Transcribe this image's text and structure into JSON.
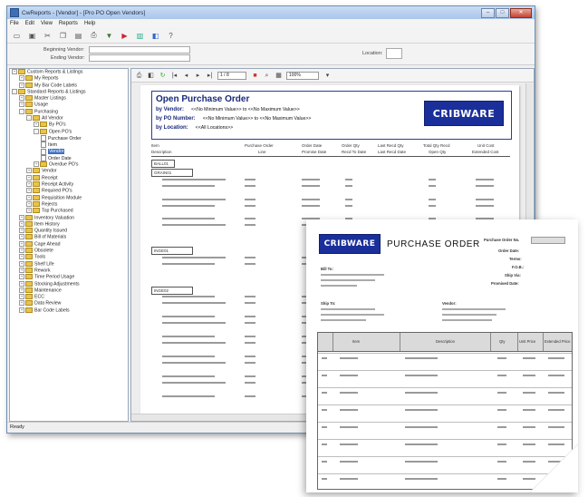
{
  "window": {
    "title": "CwReports - [Vendor] - [Pro PO Open Vendors]",
    "menus": [
      "File",
      "Edit",
      "View",
      "Reports",
      "Help"
    ]
  },
  "params": {
    "beginning_vendor_label": "Beginning Vendor:",
    "ending_vendor_label": "Ending Vendor:",
    "location_label": "Location:"
  },
  "tree": [
    {
      "label": "Custom Reports & Listings",
      "kind": "folder",
      "indent": 0,
      "expander": "+"
    },
    {
      "label": "My Reports",
      "kind": "folder",
      "indent": 1,
      "expander": "+"
    },
    {
      "label": "My Bar Code Labels",
      "kind": "folder",
      "indent": 1,
      "expander": "+"
    },
    {
      "label": "Standard Reports & Listings",
      "kind": "folder",
      "indent": 0,
      "expander": "-"
    },
    {
      "label": "Master Listings",
      "kind": "folder",
      "indent": 1,
      "expander": "+"
    },
    {
      "label": "Usage",
      "kind": "folder",
      "indent": 1,
      "expander": "+"
    },
    {
      "label": "Purchasing",
      "kind": "folder",
      "indent": 1,
      "expander": "-"
    },
    {
      "label": "All Vendor",
      "kind": "folder",
      "indent": 2,
      "expander": "-"
    },
    {
      "label": "By PO's",
      "kind": "folder",
      "indent": 3,
      "expander": "+"
    },
    {
      "label": "Open PO's",
      "kind": "folder",
      "indent": 3,
      "expander": "-"
    },
    {
      "label": "Purchase Order",
      "kind": "doc",
      "indent": 4,
      "expander": ""
    },
    {
      "label": "Item",
      "kind": "doc",
      "indent": 4,
      "expander": ""
    },
    {
      "label": "Vendor",
      "kind": "doc",
      "indent": 4,
      "expander": "",
      "selected": true
    },
    {
      "label": "Order Date",
      "kind": "doc",
      "indent": 4,
      "expander": ""
    },
    {
      "label": "Overdue PO's",
      "kind": "folder",
      "indent": 3,
      "expander": "+"
    },
    {
      "label": "Vendor",
      "kind": "folder",
      "indent": 2,
      "expander": "+"
    },
    {
      "label": "Receipt",
      "kind": "folder",
      "indent": 2,
      "expander": "+"
    },
    {
      "label": "Receipt Activity",
      "kind": "folder",
      "indent": 2,
      "expander": "+"
    },
    {
      "label": "Required PO's",
      "kind": "folder",
      "indent": 2,
      "expander": "+"
    },
    {
      "label": "Requisition Module",
      "kind": "folder",
      "indent": 2,
      "expander": "+"
    },
    {
      "label": "Rejects",
      "kind": "folder",
      "indent": 2,
      "expander": "+"
    },
    {
      "label": "Top Purchased",
      "kind": "folder",
      "indent": 2,
      "expander": "+"
    },
    {
      "label": "Inventory Valuation",
      "kind": "folder",
      "indent": 1,
      "expander": "+"
    },
    {
      "label": "Item History",
      "kind": "folder",
      "indent": 1,
      "expander": "+"
    },
    {
      "label": "Quantity Issued",
      "kind": "folder",
      "indent": 1,
      "expander": "+"
    },
    {
      "label": "Bill of Materials",
      "kind": "folder",
      "indent": 1,
      "expander": "+"
    },
    {
      "label": "Cage Ahead",
      "kind": "folder",
      "indent": 1,
      "expander": "+"
    },
    {
      "label": "Obsolete",
      "kind": "folder",
      "indent": 1,
      "expander": "+"
    },
    {
      "label": "Tools",
      "kind": "folder",
      "indent": 1,
      "expander": "+"
    },
    {
      "label": "Shelf Life",
      "kind": "folder",
      "indent": 1,
      "expander": "+"
    },
    {
      "label": "Rework",
      "kind": "folder",
      "indent": 1,
      "expander": "+"
    },
    {
      "label": "Time Period Usage",
      "kind": "folder",
      "indent": 1,
      "expander": "+"
    },
    {
      "label": "Stocking Adjustments",
      "kind": "folder",
      "indent": 1,
      "expander": "+"
    },
    {
      "label": "Maintenance",
      "kind": "folder",
      "indent": 1,
      "expander": "+"
    },
    {
      "label": "ECC",
      "kind": "folder",
      "indent": 1,
      "expander": "+"
    },
    {
      "label": "Data Review",
      "kind": "folder",
      "indent": 1,
      "expander": "+"
    },
    {
      "label": "Bar Code Labels",
      "kind": "folder",
      "indent": 1,
      "expander": "+"
    }
  ],
  "viewer": {
    "page_field": "1 / 8",
    "zoom_field": "100%"
  },
  "report": {
    "title": "Open Purchase Order",
    "line1_label": "by Vendor:",
    "line1_value": "<<No Minimum Value>> to <<No Maximum Value>>",
    "line2_label": "by PO Number:",
    "line2_value": "<<No Minimum Value>> to <<No Maximum Value>>",
    "line3_label": "by Location:",
    "line3_value": "<<All Locations>>",
    "logo_text": "CRIBWARE",
    "columns": [
      "Item",
      "Purchase Order",
      "Order Date",
      "Order Qty",
      "Last Recd Qty",
      "Total Qty Recd",
      "Unit Cost"
    ],
    "columns_sub": [
      "Description",
      "Line",
      "Promise Date",
      "Recd To Date",
      "Last Recd Date",
      "Open Qty",
      "Extended Cost"
    ],
    "vendor_groups": [
      "BALL01",
      "GRAIN01",
      "INGE01",
      "INGE02"
    ]
  },
  "status_bar": "Ready",
  "po_doc": {
    "logo_text": "CRIBWARE",
    "title": "PURCHASE ORDER",
    "po_label": "Purchase Order No.",
    "order_date_label": "Order Date:",
    "terms_label": "Terms:",
    "fob_label": "F.O.B.:",
    "ship_via_label": "Ship Via:",
    "promised_date_label": "Promised Date:",
    "ship_to_label": "Ship To:",
    "bill_to_label": "Bill To:",
    "vendor_label": "Vendor:",
    "line_items_header": [
      "Item",
      "Description",
      "Qty",
      "Unit Price",
      "Extended Price"
    ]
  },
  "colors": {
    "report_blue": "#1a2a7a",
    "logo_bg": "#1b2f9b",
    "logo_accent": "#ff3b3b",
    "selection": "#3b6fc4"
  }
}
